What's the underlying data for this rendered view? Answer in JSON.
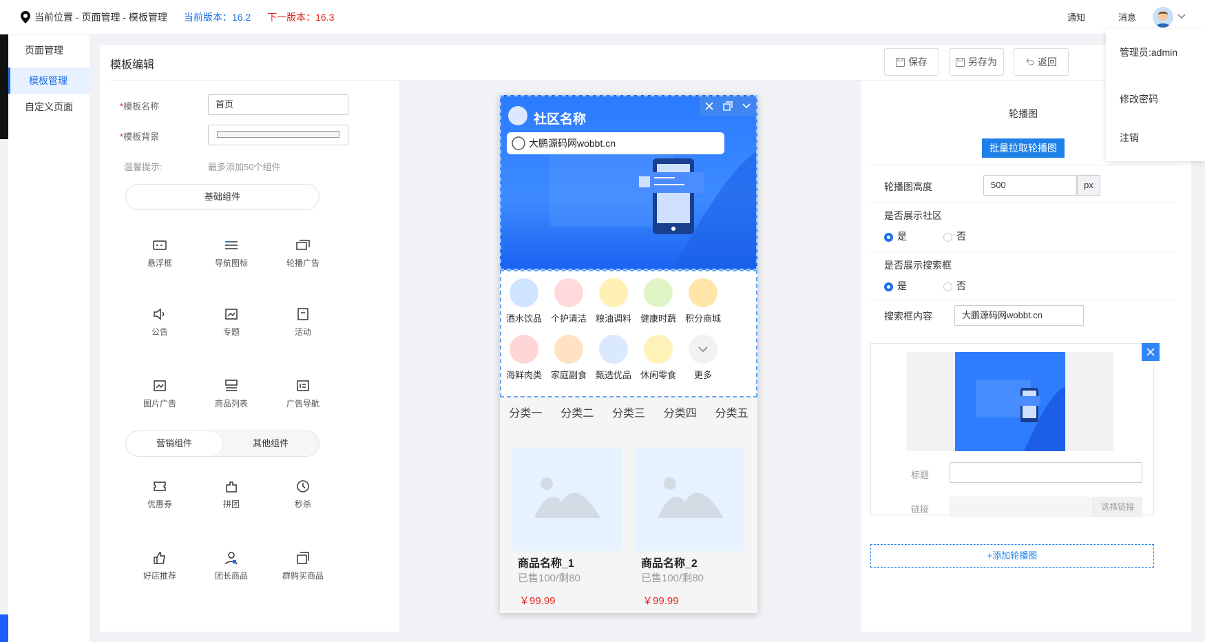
{
  "topbar": {
    "location_label": "当前位置 - 页面管理 - 模板管理",
    "current_version": "当前版本：16.2",
    "next_version": "下一版本：16.3",
    "notice": "通知",
    "message": "消息"
  },
  "sidenav": {
    "items": [
      {
        "label": "页面管理"
      },
      {
        "label": "模板管理"
      },
      {
        "label": "自定义页面"
      }
    ]
  },
  "header": {
    "title": "模板编辑",
    "save": "保存",
    "save_as": "另存为",
    "back": "返回"
  },
  "form": {
    "name_label": "模板名称",
    "name_value": "首页",
    "bg_label": "模板背景",
    "tip_label": "温馨提示:",
    "tip_value": "最多添加50个组件",
    "basic_tab": "基础组件",
    "marketing_tab": "营销组件",
    "other_tab": "其他组件"
  },
  "components_basic": [
    {
      "label": "悬浮框",
      "icon": "float-box-icon"
    },
    {
      "label": "导航图标",
      "icon": "nav-icon"
    },
    {
      "label": "轮播广告",
      "icon": "carousel-icon"
    },
    {
      "label": "公告",
      "icon": "speaker-icon"
    },
    {
      "label": "专题",
      "icon": "topic-icon"
    },
    {
      "label": "活动",
      "icon": "activity-icon"
    },
    {
      "label": "图片广告",
      "icon": "image-ad-icon"
    },
    {
      "label": "商品列表",
      "icon": "product-list-icon"
    },
    {
      "label": "广告导航",
      "icon": "ad-nav-icon"
    }
  ],
  "components_marketing": [
    {
      "label": "优惠券",
      "icon": "coupon-icon"
    },
    {
      "label": "拼团",
      "icon": "group-buy-icon"
    },
    {
      "label": "秒杀",
      "icon": "flash-sale-icon"
    },
    {
      "label": "好店推荐",
      "icon": "thumb-up-icon"
    },
    {
      "label": "团长商品",
      "icon": "leader-icon"
    },
    {
      "label": "群购买商品",
      "icon": "group-purchase-icon"
    }
  ],
  "phone": {
    "community_name": "社区名称",
    "search_text": "大鹏源码网wobbt.cn",
    "categories": [
      {
        "label": "酒水饮品",
        "color": "#cfe4ff"
      },
      {
        "label": "个护清洁",
        "color": "#ffd9dc"
      },
      {
        "label": "粮油调料",
        "color": "#fff0b3"
      },
      {
        "label": "健康时蔬",
        "color": "#dff5c6"
      },
      {
        "label": "积分商城",
        "color": "#ffe6a8"
      },
      {
        "label": "海鲜肉类",
        "color": "#ffd5d5"
      },
      {
        "label": "家庭副食",
        "color": "#ffe2c4"
      },
      {
        "label": "甄选优品",
        "color": "#dbe9ff"
      },
      {
        "label": "休闲零食",
        "color": "#fff2b8"
      },
      {
        "label": "更多",
        "color": "#f2f2f2"
      }
    ],
    "tabs": [
      "分类一",
      "分类二",
      "分类三",
      "分类四",
      "分类五"
    ],
    "products": [
      {
        "name": "商品名称_1",
        "sold": "已售100/剩80",
        "price": "￥99.99"
      },
      {
        "name": "商品名称_2",
        "sold": "已售100/剩80",
        "price": "￥99.99"
      }
    ]
  },
  "config": {
    "title": "轮播图",
    "batch_btn": "批量拉取轮播图",
    "height_label": "轮播图高度",
    "height_value": "500",
    "height_unit": "px",
    "show_community_label": "是否展示社区",
    "show_search_label": "是否展示搜索框",
    "yes": "是",
    "no": "否",
    "search_content_label": "搜索框内容",
    "search_content_value": "大鹏源码网wobbt.cn",
    "item_title_label": "标题",
    "item_link_label": "链接",
    "choose_link": "选择链接",
    "add_carousel": "+添加轮播图"
  },
  "dropdown": {
    "admin": "管理员:admin",
    "change_password": "修改密码",
    "logout": "注销"
  },
  "colors": {
    "accent": "#1e6fe8",
    "danger": "#e02020"
  }
}
